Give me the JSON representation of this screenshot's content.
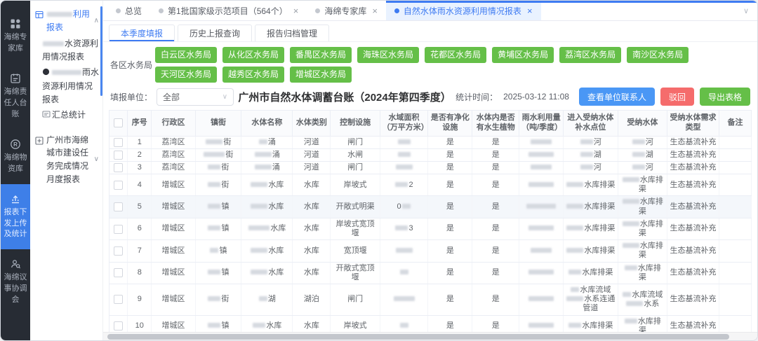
{
  "colors": {
    "accent_blue": "#3e7bf2",
    "rail_bg": "#272c34",
    "rail_active_bg": "#3e7fe8",
    "bureau_green": "#65bf48",
    "action_blue": "#4a97f5",
    "action_red": "#f56c6c",
    "action_green": "#65bf48",
    "active_tab_bg": "#e9f2ff"
  },
  "left_rail": {
    "items": [
      {
        "icon": "grid-icon",
        "label": "海绵专家库",
        "active": false
      },
      {
        "icon": "ledger-icon",
        "label": "海绵责任人台账",
        "active": false
      },
      {
        "icon": "registered-icon",
        "label": "海绵物资库",
        "active": false
      },
      {
        "icon": "report-upload-icon",
        "label": "报表下发上传及统计",
        "active": true
      },
      {
        "icon": "meeting-icon",
        "label": "海绵议事协调会",
        "active": false
      }
    ]
  },
  "sidebar": {
    "groups": [
      {
        "icon": "report-table-icon",
        "label": "░░░░░░利用报表",
        "chevron": "up",
        "active": true,
        "children": [
          {
            "icon": null,
            "label": "░░░░░水资源利用情况报表",
            "selected": true
          },
          {
            "icon": "org-badge-icon",
            "label": "░░░░░░░雨水资源利用情况报表",
            "selected": false
          },
          {
            "icon": "summary-icon",
            "label": "汇总统计",
            "selected": false
          }
        ]
      },
      {
        "icon": "plus-square-icon",
        "label": "广州市海绵城市建设任务完成情况月度报表",
        "chevron": "down",
        "active": false,
        "children": []
      }
    ]
  },
  "tab_bar": {
    "tabs": [
      {
        "label": "总览",
        "closable": false,
        "active": false
      },
      {
        "label": "第1批国家级示范项目（564个）",
        "closable": true,
        "active": false
      },
      {
        "label": "海绵专家库",
        "closable": true,
        "active": false
      },
      {
        "label": "自然水体雨水资源利用情况报表",
        "closable": true,
        "active": true
      }
    ]
  },
  "sub_tabs": [
    {
      "label": "本季度填报",
      "active": true
    },
    {
      "label": "历史上报查询",
      "active": false
    },
    {
      "label": "报告归档管理",
      "active": false
    }
  ],
  "bureau_bar": {
    "label": "各区水务局",
    "buttons": [
      "白云区水务局",
      "从化区水务局",
      "番禺区水务局",
      "海珠区水务局",
      "花都区水务局",
      "黄埔区水务局",
      "荔湾区水务局",
      "南沙区水务局",
      "天河区水务局",
      "越秀区水务局",
      "增城区水务局"
    ]
  },
  "toolbar": {
    "filter_label": "填报单位：",
    "filter_value": "全部",
    "title": "广州市自然水体调蓄台账（2024年第四季度）",
    "stat_time_label": "统计时间：",
    "stat_time": "2025-03-12 11:08",
    "actions": [
      {
        "label": "查看单位联系人",
        "color": "blue"
      },
      {
        "label": "驳回",
        "color": "red"
      },
      {
        "label": "导出表格",
        "color": "green"
      }
    ]
  },
  "table": {
    "headers": [
      "序号",
      "行政区",
      "镇街",
      "水体名称",
      "水体类别",
      "控制设施",
      "水域面积（万平方米）",
      "是否有净化设施",
      "水体内是否有水生植物",
      "雨水利用量（吨/季度）",
      "进入受纳水体补水点位",
      "受纳水体",
      "受纳水体需求类型",
      "备注"
    ],
    "rows": [
      {
        "highlight": false,
        "cells": [
          "1",
          "荔湾区",
          "░░░░街",
          "░░涌",
          "河道",
          "闸门",
          "░░░",
          "是",
          "是",
          "░░░░░",
          "░░░河",
          "░░░河",
          "生态基流补充",
          ""
        ]
      },
      {
        "highlight": false,
        "cells": [
          "2",
          "荔湾区",
          "░░░░░街",
          "░░░░涌",
          "河道",
          "水闸",
          "░░░",
          "是",
          "是",
          "░░░░░░",
          "░░░湖",
          "░░░湖",
          "生态基流补充",
          ""
        ]
      },
      {
        "highlight": false,
        "cells": [
          "3",
          "荔湾区",
          "░░░街",
          "░░░░涌",
          "河道",
          "闸门",
          "░░░░",
          "是",
          "是",
          "░░░░░",
          "░░░河",
          "░░░河",
          "生态基流补充",
          ""
        ]
      },
      {
        "highlight": false,
        "cells": [
          "4",
          "增城区",
          "░░░街",
          "░░░░水库",
          "水库",
          "岸坡式",
          "░░░2",
          "是",
          "是",
          "░░░░░░",
          "░░░░水库排渠",
          "░░░░水库排渠",
          "生态基流补充",
          ""
        ]
      },
      {
        "highlight": true,
        "cells": [
          "5",
          "增城区",
          "░░░镇",
          "░░░░水库",
          "水库",
          "开敞式明渠",
          "0░░",
          "是",
          "是",
          "░░░░░░░",
          "░░░░水库排渠",
          "░░░░水库排渠",
          "生态基流补充",
          ""
        ]
      },
      {
        "highlight": false,
        "cells": [
          "6",
          "增城区",
          "░░░镇",
          "░░░░░水库",
          "水库",
          "岸坡式宽顶堰",
          "░░░3",
          "是",
          "是",
          "░░░░░░",
          "░░░░水库排渠",
          "░░░░水库排渠",
          "生态基流补充",
          ""
        ]
      },
      {
        "highlight": false,
        "cells": [
          "7",
          "增城区",
          "░░镇",
          "░░░░水库",
          "水库",
          "宽顶堰",
          "░░░░",
          "是",
          "是",
          "░░░░░",
          "░░░░水库排渠",
          "░░░░水库排渠",
          "生态基流补充",
          ""
        ]
      },
      {
        "highlight": false,
        "cells": [
          "8",
          "增城区",
          "░░░镇",
          "░░░░水库",
          "水库",
          "开敞式宽顶堰",
          "░░",
          "是",
          "是",
          "░░░░░░",
          "░░░水库排渠",
          "░░░水库排渠",
          "生态基流补充",
          ""
        ]
      },
      {
        "highlight": false,
        "cells": [
          "9",
          "增城区",
          "░░░街",
          "░░湖",
          "湖泊",
          "闸门",
          "░░░░░",
          "是",
          "是",
          "░░░░░░",
          "░░水库流域░░░░水系连通管道",
          "░░水库流域░░░░水系",
          "生态基流补充",
          ""
        ]
      },
      {
        "highlight": false,
        "cells": [
          "10",
          "增城区",
          "░░░镇",
          "░░░水库",
          "水库",
          "岸坡式",
          "░░",
          "是",
          "是",
          "░░░░░░",
          "░░░水库排渠",
          "░░░水库排渠",
          "生态基流补充",
          ""
        ]
      }
    ]
  }
}
